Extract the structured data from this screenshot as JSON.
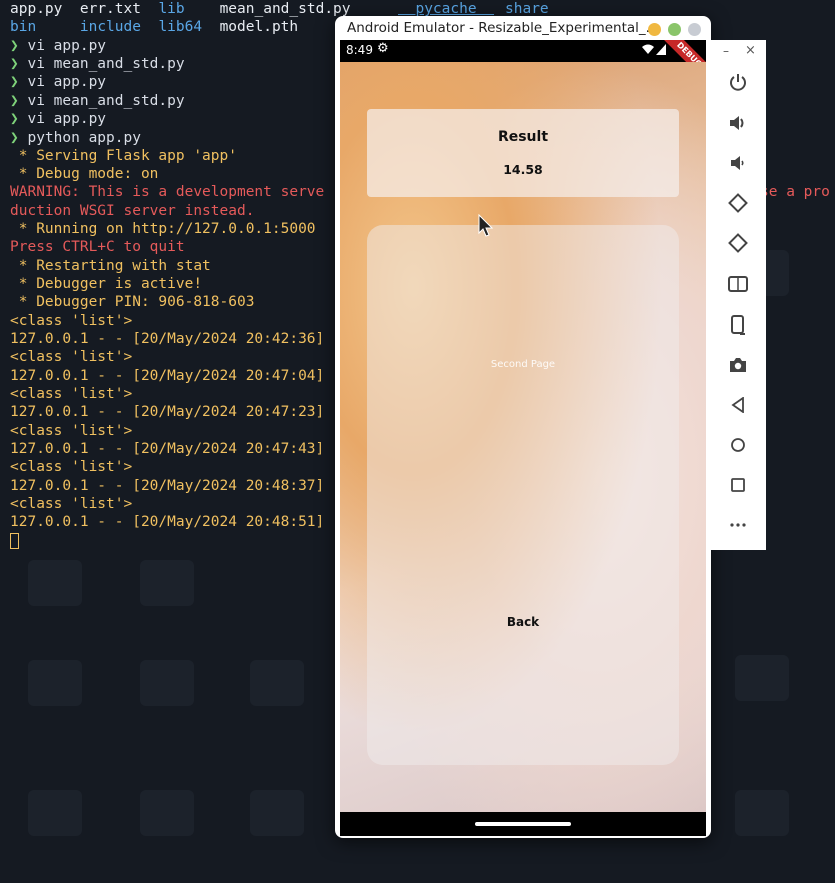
{
  "terminal": {
    "ls_row1": [
      "app.py",
      "err.txt",
      "lib",
      "mean_and_std.py",
      "__pycache__",
      "share"
    ],
    "ls_row2": [
      "bin",
      "include",
      "lib64",
      "model.pth"
    ],
    "prompt_symbol": "❯",
    "commands": [
      "vi app.py",
      "vi mean_and_std.py",
      "vi app.py",
      "vi mean_and_std.py",
      "vi app.py",
      "python app.py"
    ],
    "serving": " * Serving Flask app 'app'",
    "debug_mode": " * Debug mode: on",
    "warning_line1": "WARNING: This is a development serve",
    "warning_line1_tail": "se a pro",
    "warning_line2": "duction WSGI server instead.",
    "running": " * Running on http://127.0.0.1:5000",
    "quit": "Press CTRL+C to quit",
    "restarting": " * Restarting with stat",
    "debugger_active": " * Debugger is active!",
    "debugger_pin": " * Debugger PIN: 906-818-603",
    "class_list": "<class 'list'>",
    "requests": [
      "127.0.0.1 - - [20/May/2024 20:42:36]",
      "127.0.0.1 - - [20/May/2024 20:47:04]",
      "127.0.0.1 - - [20/May/2024 20:47:23]",
      "127.0.0.1 - - [20/May/2024 20:47:43]",
      "127.0.0.1 - - [20/May/2024 20:48:37]",
      "127.0.0.1 - - [20/May/2024 20:48:51]"
    ]
  },
  "emulator": {
    "title": "Android Emulator - Resizable_Experimental_...",
    "status_time": "8:49",
    "debug_label": "DEBUG",
    "result_title": "Result",
    "result_value": "14.58",
    "second_page_label": "Second Page",
    "back_label": "Back"
  },
  "toolbar": {
    "minimize": "–",
    "close": "×",
    "buttons": [
      "power",
      "volume-up",
      "volume-down",
      "rotate-left",
      "rotate-right",
      "take-screenshot-alt",
      "fold",
      "camera",
      "back",
      "home",
      "overview",
      "more"
    ]
  },
  "colors": {
    "terminal_bg": "#151a22",
    "prompt": "#7ed27a",
    "warning": "#e55a5a",
    "log": "#f0c060",
    "directory": "#5aa7e6"
  }
}
